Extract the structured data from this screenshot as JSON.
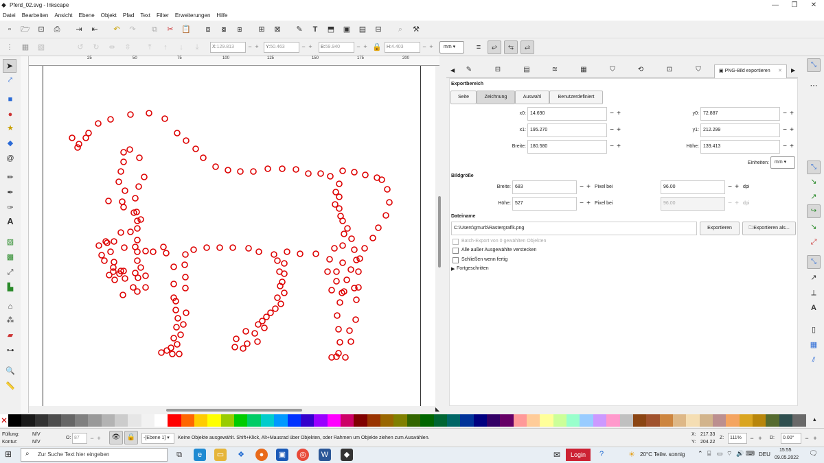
{
  "window": {
    "title": "Pferd_02.svg - Inkscape"
  },
  "menu": [
    "Datei",
    "Bearbeiten",
    "Ansicht",
    "Ebene",
    "Objekt",
    "Pfad",
    "Text",
    "Filter",
    "Erweiterungen",
    "Hilfe"
  ],
  "toolctrl": {
    "x_label": "X:",
    "x_value": "129.813",
    "y_label": "Y:",
    "y_value": "50.463",
    "b_label": "B:",
    "b_value": "59.940",
    "h_label": "H:",
    "h_value": "4.403",
    "unit": "mm"
  },
  "ruler_labels": [
    "25",
    "50",
    "75",
    "100",
    "125",
    "150",
    "175",
    "200"
  ],
  "panel": {
    "tab_label": "PNG-Bild exportieren",
    "export_area_title": "Exportbereich",
    "area_buttons": [
      "Seite",
      "Zeichnung",
      "Auswahl",
      "Benutzerdefiniert"
    ],
    "active_area": "Zeichnung",
    "x0_label": "x0:",
    "x0": "14.690",
    "y0_label": "y0:",
    "y0": "72.887",
    "x1_label": "x1:",
    "x1": "195.270",
    "y1_label": "y1:",
    "y1": "212.299",
    "breite_label": "Breite:",
    "breite": "180.580",
    "hoehe_label": "Höhe:",
    "hoehe": "139.413",
    "units_label": "Einheiten:",
    "units": "mm",
    "image_size_title": "Bildgröße",
    "img_breite_label": "Breite:",
    "img_breite": "683",
    "img_hoehe_label": "Höhe:",
    "img_hoehe": "527",
    "pixel_at": "Pixel bei",
    "dpi1": "96.00",
    "dpi2": "96.00",
    "dpi_unit": "dpi",
    "filename_title": "Dateiname",
    "filename": "C:\\Users\\gmurb\\Rastergrafik.png",
    "export_btn": "Exportieren",
    "export_as_btn": "Exportieren als...",
    "batch_label": "Batch-Export von 0 gewählten Objekten",
    "hide_label": "Alle außer Ausgewählte verstecken",
    "close_label": "Schließen wenn fertig",
    "advanced_label": "Fortgeschritten"
  },
  "status": {
    "fill_label": "Füllung:",
    "fill_value": "N/V",
    "stroke_label": "Kontur:",
    "stroke_value": "N/V",
    "opacity_label": "O:",
    "opacity_value": "87",
    "layer": "-[Ebene 1]",
    "message": "Keine Objekte ausgewählt. Shift+Klick, Alt+Mausrad über Objekten, oder Rahmen um Objekte ziehen zum Auswählen.",
    "x_label": "X:",
    "x_value": "217.33",
    "y_label": "Y:",
    "y_value": "204.22",
    "z_label": "Z:",
    "zoom": "111%",
    "d_label": "D:",
    "rotation": "0.00°"
  },
  "taskbar": {
    "search_placeholder": "Zur Suche Text hier eingeben",
    "login": "Login",
    "weather": "20°C Teilw. sonnig",
    "lang": "DEU",
    "time": "15:55",
    "date": "09.05.2022"
  },
  "colors": {
    "accent": "#dd0000",
    "palette": [
      "#000000",
      "#1a1a1a",
      "#333333",
      "#4d4d4d",
      "#666666",
      "#808080",
      "#999999",
      "#b3b3b3",
      "#cccccc",
      "#e6e6e6",
      "#f2f2f2",
      "#ffffff",
      "#ff0000",
      "#ff6600",
      "#ffcc00",
      "#ffff00",
      "#99cc00",
      "#00cc00",
      "#00cc66",
      "#00cccc",
      "#0099ff",
      "#0033ff",
      "#3300cc",
      "#9900ff",
      "#ff00ff",
      "#cc0066",
      "#800000",
      "#993300",
      "#996600",
      "#808000",
      "#336600",
      "#006600",
      "#006633",
      "#006666",
      "#003399",
      "#000080",
      "#330066",
      "#660066",
      "#ff9999",
      "#ffcc99",
      "#ffff99",
      "#ccff99",
      "#99ffcc",
      "#99ccff",
      "#cc99ff",
      "#ff99cc",
      "#c0c0c0",
      "#8b4513",
      "#a0522d",
      "#cd853f",
      "#deb887",
      "#f5deb3",
      "#d2b48c",
      "#bc8f8f",
      "#f4a460",
      "#daa520",
      "#b8860b",
      "#556b2f",
      "#2f4f4f",
      "#696969"
    ]
  }
}
